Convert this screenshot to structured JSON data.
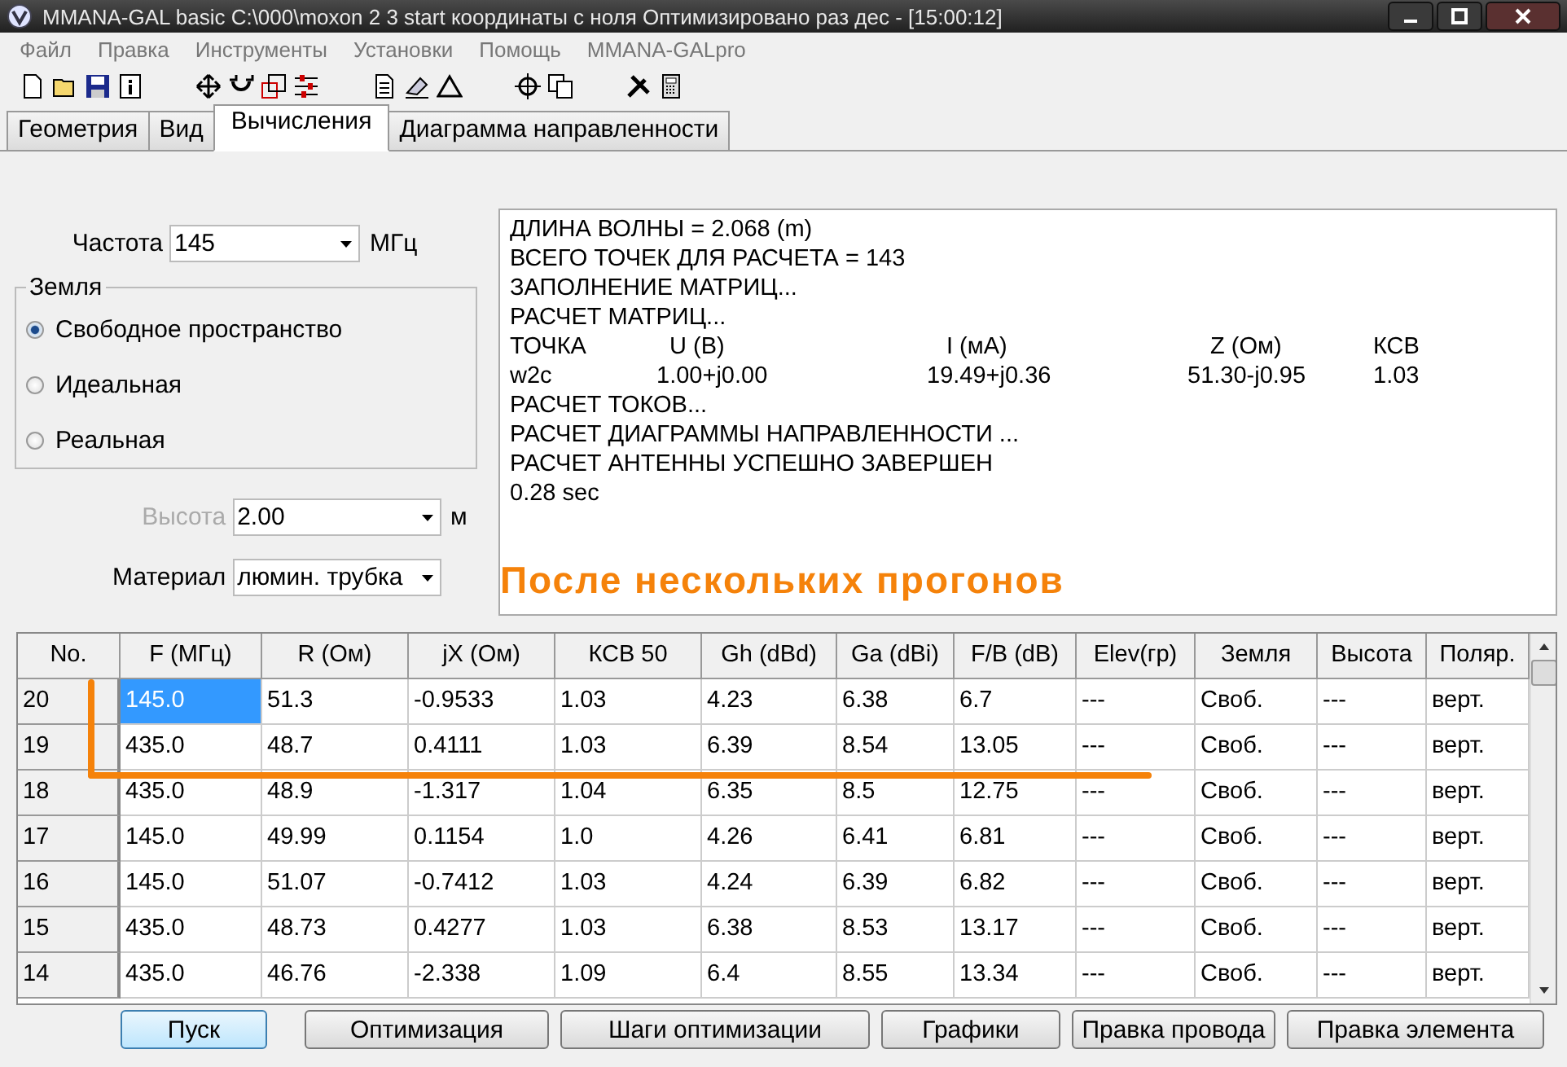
{
  "window": {
    "title": "MMANA-GAL basic  C:\\000\\moxon 2 3 start координаты с ноля Оптимизировано раз дес - [15:00:12]"
  },
  "menu": [
    "Файл",
    "Правка",
    "Инструменты",
    "Установки",
    "Помощь",
    "MMANA-GALpro"
  ],
  "tabs": [
    {
      "label": "Геометрия",
      "selected": false
    },
    {
      "label": "Вид",
      "selected": false
    },
    {
      "label": "Вычисления",
      "selected": true
    },
    {
      "label": "Диаграмма направленности",
      "selected": false
    }
  ],
  "frequency": {
    "label": "Частота",
    "value": "145",
    "unit": "МГц"
  },
  "ground": {
    "title": "Земля",
    "options": [
      {
        "label": "Свободное пространство",
        "selected": true
      },
      {
        "label": "Идеальная",
        "selected": false
      },
      {
        "label": "Реальная",
        "selected": false
      }
    ]
  },
  "height": {
    "label": "Высота",
    "value": "2.00",
    "unit": "м",
    "disabled": true
  },
  "material": {
    "label": "Материал",
    "value": "люмин. трубка"
  },
  "output": {
    "lines_before": [
      "ДЛИНА ВОЛНЫ = 2.068 (m)",
      "ВСЕГО ТОЧЕК ДЛЯ РАСЧЕТА = 143",
      "ЗАПОЛНЕНИЕ МАТРИЦ...",
      "РАСЧЕТ МАТРИЦ..."
    ],
    "point_table": {
      "columns": [
        "ТОЧКА",
        "U (B)",
        "I (мА)",
        "Z (Ом)",
        "КСВ"
      ],
      "rows": [
        [
          "w2c",
          "1.00+j0.00",
          "19.49+j0.36",
          "51.30-j0.95",
          "1.03"
        ]
      ]
    },
    "lines_after": [
      "РАСЧЕТ ТОКОВ...",
      "РАСЧЕТ ДИАГРАММЫ НАПРАВЛЕННОСТИ ...",
      "РАСЧЕТ АНТЕННЫ УСПЕШНО ЗАВЕРШЕН",
      "0.28 sec"
    ],
    "annotation": "После нескольких прогонов"
  },
  "results": {
    "columns": [
      "No.",
      "F (МГц)",
      "R (Ом)",
      "jX (Ом)",
      "КСВ 50",
      "Gh (dBd)",
      "Ga (dBi)",
      "F/B (dB)",
      "Elev(гр)",
      "Земля",
      "Высота",
      "Поляр."
    ],
    "rows": [
      {
        "f_selected": true,
        "cells": [
          "20",
          "145.0",
          "51.3",
          "-0.9533",
          "1.03",
          "4.23",
          "6.38",
          "6.7",
          "---",
          "Своб.",
          "---",
          "верт."
        ]
      },
      {
        "f_selected": false,
        "cells": [
          "19",
          "435.0",
          "48.7",
          "0.4111",
          "1.03",
          "6.39",
          "8.54",
          "13.05",
          "---",
          "Своб.",
          "---",
          "верт."
        ]
      },
      {
        "f_selected": false,
        "cells": [
          "18",
          "435.0",
          "48.9",
          "-1.317",
          "1.04",
          "6.35",
          "8.5",
          "12.75",
          "---",
          "Своб.",
          "---",
          "верт."
        ]
      },
      {
        "f_selected": false,
        "cells": [
          "17",
          "145.0",
          "49.99",
          "0.1154",
          "1.0",
          "4.26",
          "6.41",
          "6.81",
          "---",
          "Своб.",
          "---",
          "верт."
        ]
      },
      {
        "f_selected": false,
        "cells": [
          "16",
          "145.0",
          "51.07",
          "-0.7412",
          "1.03",
          "4.24",
          "6.39",
          "6.82",
          "---",
          "Своб.",
          "---",
          "верт."
        ]
      },
      {
        "f_selected": false,
        "cells": [
          "15",
          "435.0",
          "48.73",
          "0.4277",
          "1.03",
          "6.38",
          "8.53",
          "13.17",
          "---",
          "Своб.",
          "---",
          "верт."
        ]
      },
      {
        "f_selected": false,
        "cells": [
          "14",
          "435.0",
          "46.76",
          "-2.338",
          "1.09",
          "6.4",
          "8.55",
          "13.34",
          "---",
          "Своб.",
          "---",
          "верт."
        ]
      }
    ]
  },
  "buttons": [
    {
      "label": "Пуск",
      "focused": true
    },
    {
      "label": "Оптимизация",
      "focused": false
    },
    {
      "label": "Шаги оптимизации",
      "focused": false
    },
    {
      "label": "Графики",
      "focused": false
    },
    {
      "label": "Правка провода",
      "focused": false
    },
    {
      "label": "Правка элемента",
      "focused": false
    }
  ]
}
